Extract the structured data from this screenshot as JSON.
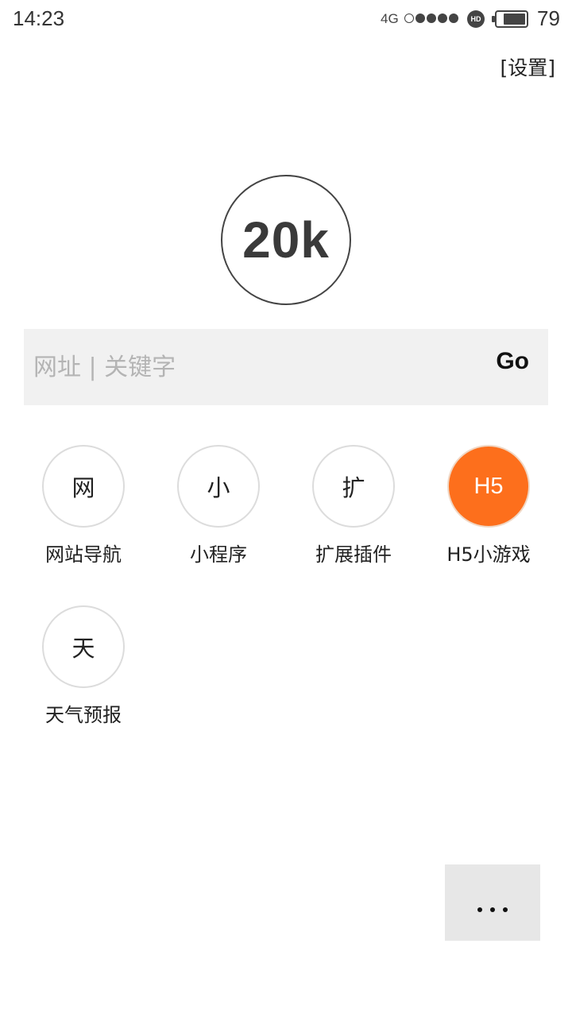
{
  "status_bar": {
    "time": "14:23",
    "network": "4G",
    "signal_bars_filled": 4,
    "signal_bars_total": 5,
    "hd_label": "HD",
    "battery_level": "79"
  },
  "settings_label": "[设置]",
  "logo": {
    "text": "20k"
  },
  "search": {
    "placeholder": "网址 | 关键字",
    "value": "",
    "go_label": "Go"
  },
  "shortcuts": [
    {
      "icon_text": "网",
      "label": "网站导航",
      "accent": false
    },
    {
      "icon_text": "小",
      "label": "小程序",
      "accent": false
    },
    {
      "icon_text": "扩",
      "label": "扩展插件",
      "accent": false
    },
    {
      "icon_text": "H5",
      "label": "H5小游戏",
      "accent": true
    },
    {
      "icon_text": "天",
      "label": "天气预报",
      "accent": false
    }
  ],
  "colors": {
    "accent": "#fd6f1c",
    "search_background": "#f1f1f1",
    "more_button_background": "#e7e7e7"
  },
  "more_icon": "more-horizontal-icon"
}
